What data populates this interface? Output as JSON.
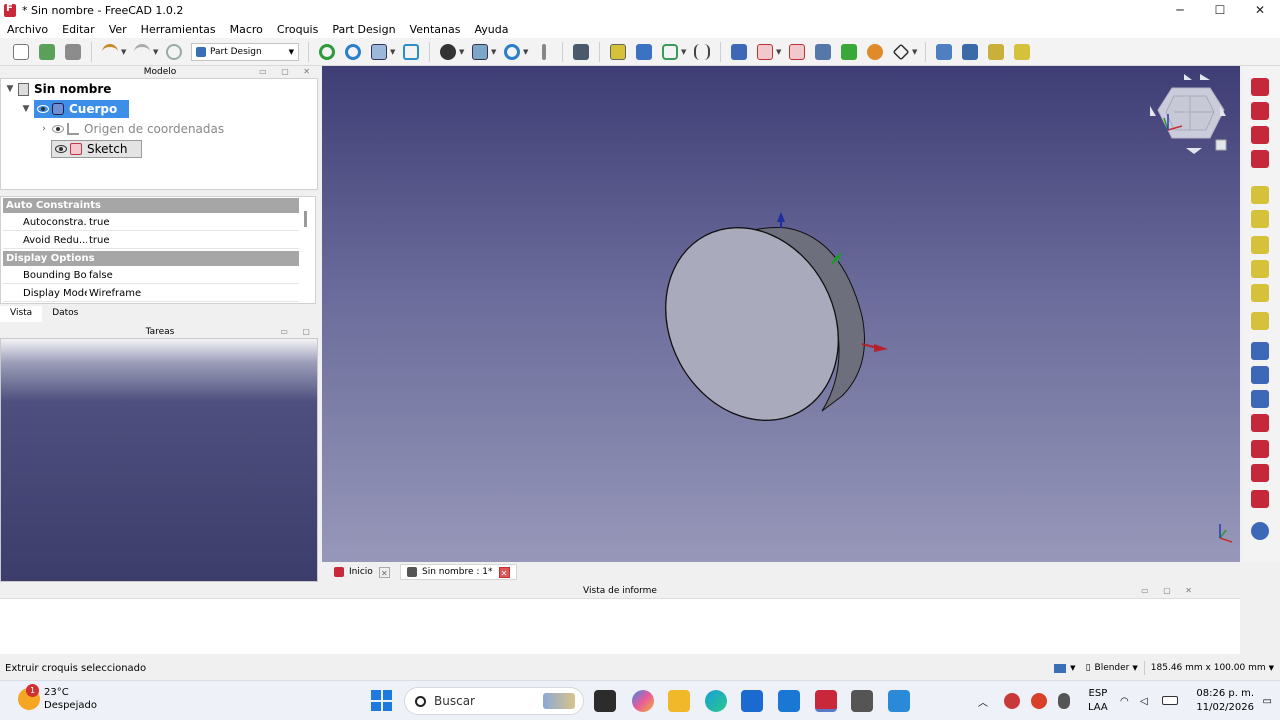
{
  "window": {
    "title": "* Sin nombre - FreeCAD 1.0.2",
    "controls": [
      "─",
      "☐",
      "✕"
    ]
  },
  "menu": [
    "Archivo",
    "Editar",
    "Ver",
    "Herramientas",
    "Macro",
    "Croquis",
    "Part Design",
    "Ventanas",
    "Ayuda"
  ],
  "toolbar": {
    "workbench": "Part Design"
  },
  "model_panel": {
    "title": "Modelo",
    "tree": {
      "document": "Sin nombre",
      "body": "Cuerpo",
      "origin": "Origen de coordenadas",
      "sketch": "Sketch"
    }
  },
  "properties": {
    "groups": [
      {
        "name": "Auto Constraints",
        "rows": [
          {
            "key": "Autoconstra...",
            "value": "true"
          },
          {
            "key": "Avoid Redu...",
            "value": "true"
          }
        ]
      },
      {
        "name": "Display Options",
        "rows": [
          {
            "key": "Bounding Box",
            "value": "false"
          },
          {
            "key": "Display Mode",
            "value": "Wireframe"
          }
        ]
      }
    ]
  },
  "panel_tabs": [
    "Vista",
    "Datos"
  ],
  "tasks_panel": {
    "title": "Tareas"
  },
  "doc_tabs": [
    {
      "label": "Inicio",
      "close": "✕"
    },
    {
      "label": "Sin nombre : 1*",
      "close": "✕"
    }
  ],
  "report_view": {
    "title": "Vista de informe"
  },
  "statusbar": {
    "message": "Extruir croquis seleccionado",
    "nav_style": "Blender",
    "dimensions": "185.46 mm x 100.00 mm"
  },
  "taskbar": {
    "temperature": "23°C",
    "weather": "Despejado",
    "notification_count": "1",
    "search_placeholder": "Buscar",
    "lang_top": "ESP",
    "lang_bottom": "LAA",
    "time": "08:26 p. m.",
    "date": "11/02/2026"
  },
  "colors": {
    "accent_selection": "#3d8ee8",
    "view_top": "#3e3d75",
    "view_bottom": "#9798b9",
    "freecad_red": "#c8283a"
  }
}
